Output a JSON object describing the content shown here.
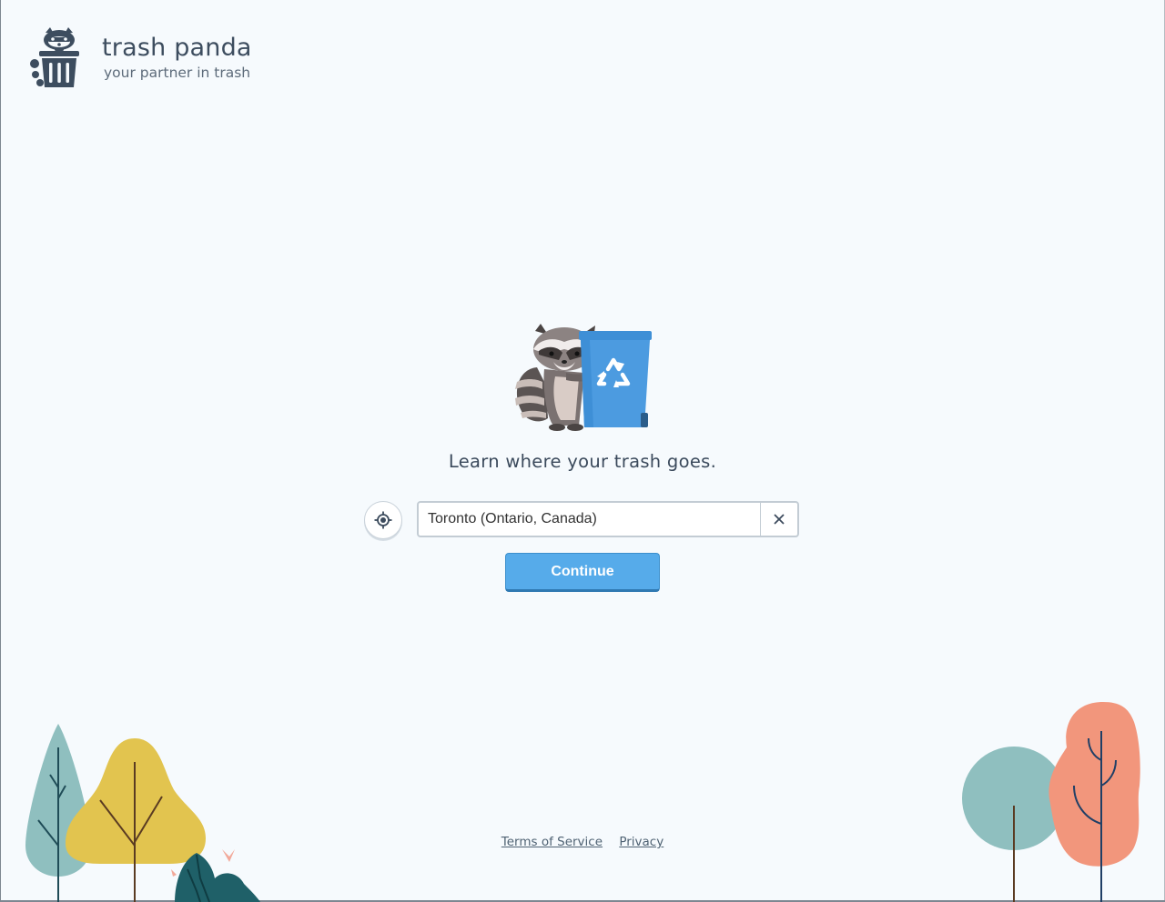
{
  "brand": {
    "name": "trash panda",
    "tagline": "your partner in trash"
  },
  "main": {
    "headline": "Learn where your trash goes.",
    "location_value": "Toronto (Ontario, Canada)",
    "continue_label": "Continue"
  },
  "footer": {
    "terms_label": "Terms of Service",
    "privacy_label": "Privacy"
  },
  "icons": {
    "logo": "raccoon-trash-can-logo",
    "locate": "crosshair-locate-icon",
    "clear": "close-x-icon",
    "hero": "raccoon-with-recycling-bin-illustration"
  },
  "colors": {
    "background": "#f6fafd",
    "accent": "#56abea",
    "bin_blue": "#3e8fd6",
    "text": "#3b4a5c",
    "tree_teal": "#8fbfbf",
    "tree_yellow": "#e2c44f",
    "tree_salmon": "#f2967c",
    "tree_dark": "#1f6068"
  }
}
